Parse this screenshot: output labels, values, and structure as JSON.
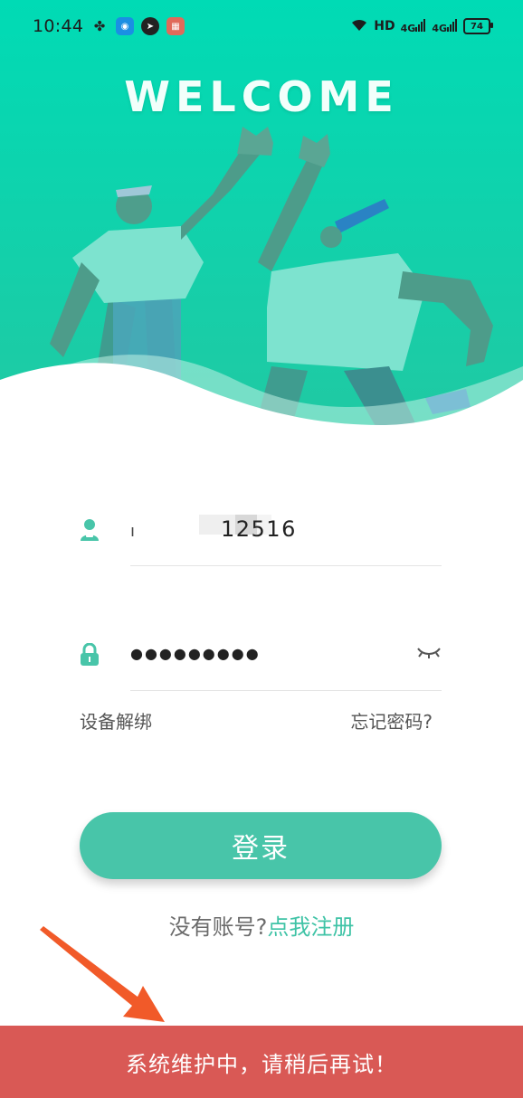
{
  "status_bar": {
    "time": "10:44",
    "network_label": "HD",
    "signal_1": "4G",
    "signal_2": "4G",
    "battery": "74"
  },
  "hero": {
    "title": "WELCOME",
    "colors": {
      "top": "#00d9b3",
      "bottom": "#20c9a0"
    }
  },
  "form": {
    "username": {
      "value": "12516",
      "icon": "user-icon"
    },
    "password": {
      "value": "●●●●●●●●●",
      "icon": "lock-icon",
      "toggle_icon": "eye-closed-icon"
    },
    "unbind_label": "设备解绑",
    "forgot_label": "忘记密码?",
    "login_label": "登录",
    "register_prompt": "没有账号?",
    "register_link": "点我注册"
  },
  "toast": {
    "message": "系统维护中，请稍后再试！"
  },
  "colors": {
    "accent": "#48c5a9",
    "link": "#3fc3a6",
    "toast_bg": "#d95955",
    "arrow": "#f15a29"
  }
}
